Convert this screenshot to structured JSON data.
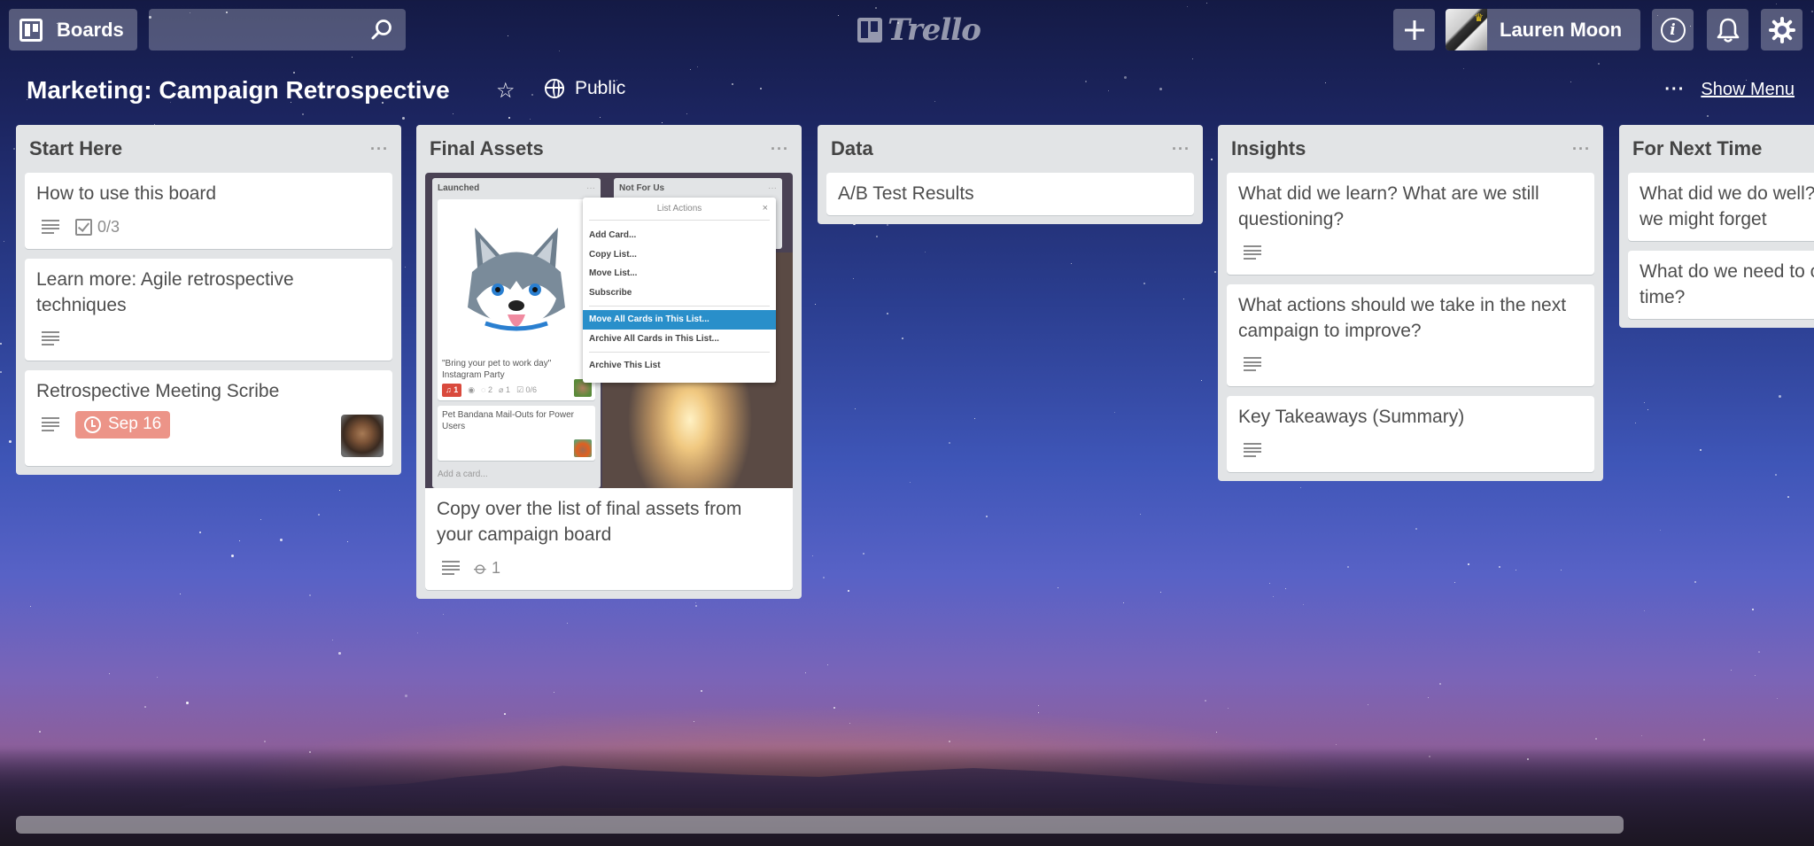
{
  "header": {
    "boards_label": "Boards",
    "search_value": "",
    "search_placeholder": "",
    "logo_text": "Trello",
    "user_name": "Lauren Moon",
    "add_icon": "plus-icon",
    "info_icon": "info-icon",
    "bell_icon": "bell-icon",
    "gear_icon": "gear-icon"
  },
  "board": {
    "title": "Marketing: Campaign Retrospective",
    "star_icon": "star-icon",
    "visibility": "Public",
    "menu_dots": "···",
    "show_menu": "Show Menu"
  },
  "lists": [
    {
      "title": "Start Here",
      "menu": "···",
      "cards": [
        {
          "title": "How to use this board",
          "description": true,
          "checklist": "0/3"
        },
        {
          "title": "Learn more: Agile retrospective techniques",
          "description": true
        },
        {
          "title": "Retrospective Meeting Scribe",
          "description": true,
          "due": "Sep 16",
          "member": true
        }
      ]
    },
    {
      "title": "Final Assets",
      "menu": "···",
      "cards": [
        {
          "title": "Copy over the list of final assets from your campaign board",
          "description": true,
          "attachments": "1",
          "cover": {
            "lists": [
              {
                "title": "Launched",
                "menu": "···",
                "cards": [
                  {
                    "title": "\"Bring your pet to work day\" Instagram Party",
                    "votes": "1",
                    "comments": "2",
                    "attachments": "1",
                    "checklist": "0/6"
                  },
                  {
                    "title": "Pet Bandana Mail-Outs for Power Users"
                  }
                ],
                "add_card": "Add a card..."
              },
              {
                "title": "Not For Us",
                "menu": "···"
              }
            ],
            "popover": {
              "title": "List Actions",
              "close": "×",
              "items": [
                "Add Card...",
                "Copy List...",
                "Move List...",
                "Subscribe",
                "Move All Cards in This List...",
                "Archive All Cards in This List...",
                "Archive This List"
              ],
              "highlighted": "Move All Cards in This List..."
            }
          }
        }
      ]
    },
    {
      "title": "Data",
      "menu": "···",
      "cards": [
        {
          "title": "A/B Test Results"
        }
      ]
    },
    {
      "title": "Insights",
      "menu": "···",
      "cards": [
        {
          "title": "What did we learn? What are we still questioning?",
          "description": true
        },
        {
          "title": "What actions should we take in the next campaign to improve?",
          "description": true
        },
        {
          "title": "Key Takeaways (Summary)",
          "description": true
        }
      ]
    },
    {
      "title": "For Next Time",
      "menu": "···",
      "cards": [
        {
          "title": "What did we do well? If we didn't discuss, we might forget"
        },
        {
          "title": "What do we need to change for next time?"
        }
      ]
    }
  ],
  "colors": {
    "list_bg": "#e2e4e6",
    "due_badge": "#ec9488",
    "popover_highlight": "#298fca",
    "vote_badge": "#d94a3d"
  }
}
